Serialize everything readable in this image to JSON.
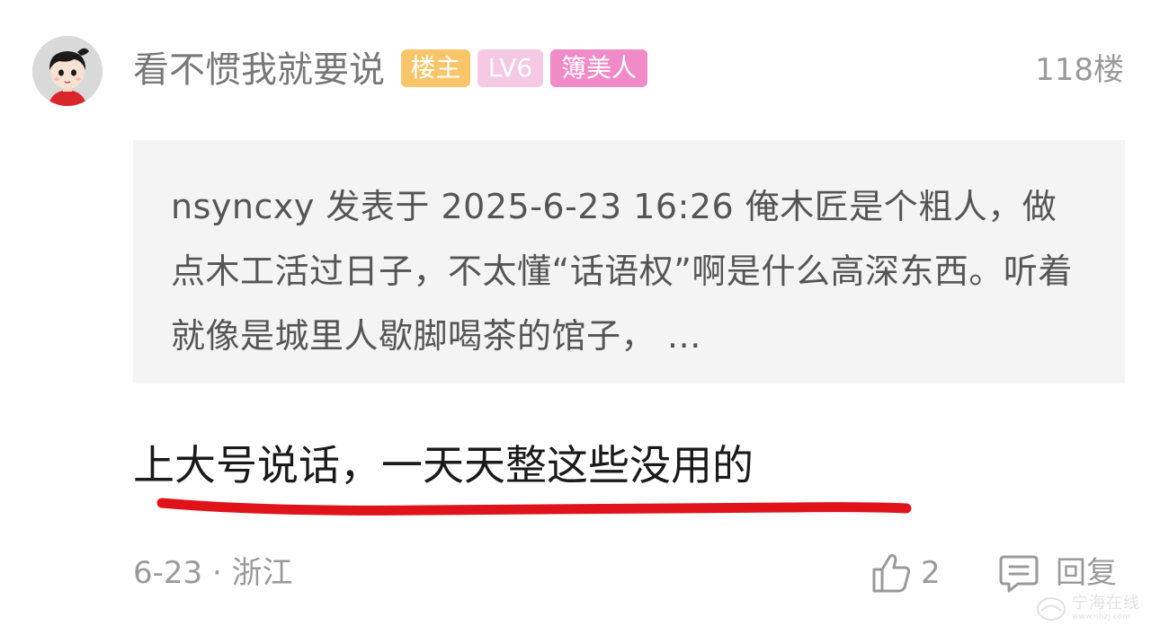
{
  "post": {
    "author": "看不惯我就要说",
    "badges": {
      "owner": "楼主",
      "level": "LV6",
      "title": "簿美人"
    },
    "floor": "118楼",
    "quote": {
      "text": "nsyncxy 发表于 2025-6-23 16:26 俺木匠是个粗人，做点木工活过日子，不太懂“话语权”啊是什么高深东西。听着就像是城里人歇脚喝茶的馆子， …"
    },
    "body": "上大号说话，一天天整这些没用的",
    "meta": "6-23 · 浙江",
    "like_count": "2",
    "reply_label": "回复"
  },
  "watermark": {
    "main": "宁海在线",
    "sub": "www.nhzj.com"
  },
  "icons": {
    "avatar": "cartoon-avatar-icon",
    "like": "thumbs-up-icon",
    "reply": "comment-bubble-icon",
    "watermark": "nhzx-logo-icon"
  },
  "colors": {
    "badge_owner": "#f8c56a",
    "badge_level": "#f5c9e4",
    "badge_title": "#f08bc8",
    "quote_bg": "#f4f4f4",
    "underline": "#e0121a"
  }
}
